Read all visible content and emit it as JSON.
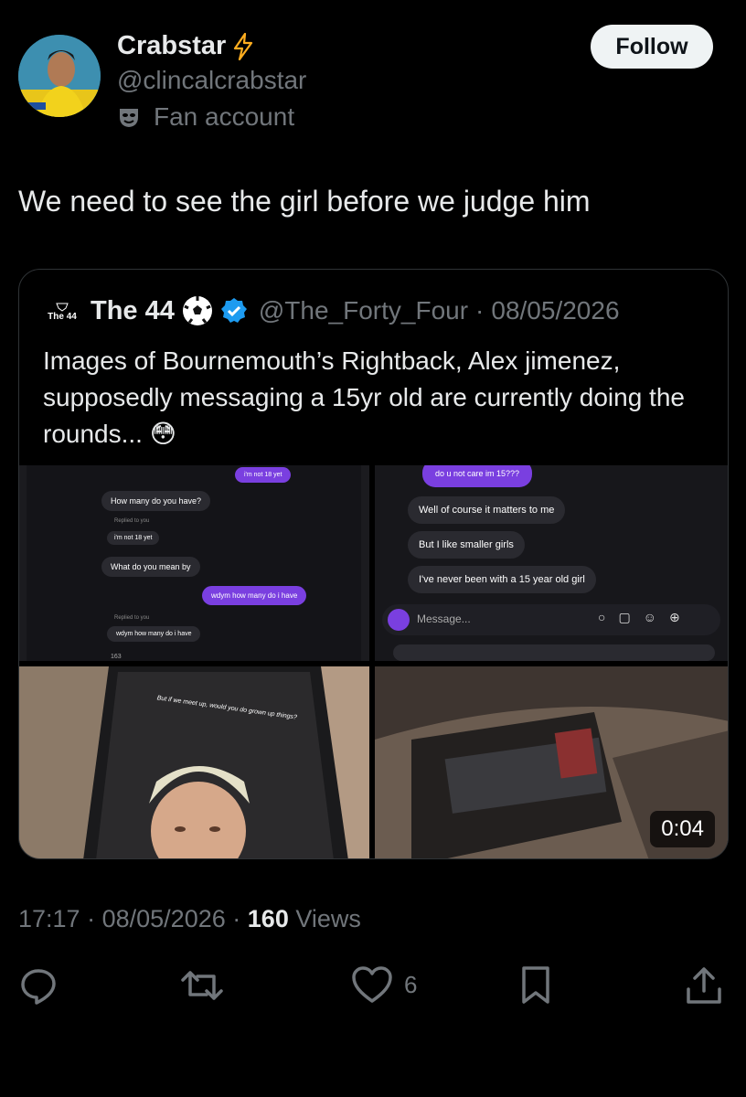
{
  "author": {
    "name": "Crabstar",
    "handle": "@clincalcrabstar",
    "label": "Fan account",
    "badge_icon": "lightning-icon"
  },
  "follow_label": "Follow",
  "tweet_text": "We need to see the girl before we judge him",
  "quote": {
    "avatar_text": "The 44",
    "name": "The 44",
    "handle": "@The_Forty_Four",
    "separator": "·",
    "date": "08/05/2026",
    "text": "Images of Bournemouth’s Rightback, Alex jimenez, supposedly messaging a 15yr old are currently doing the rounds...",
    "emoji": "😳",
    "media": {
      "tile1": {
        "msg_top": "i'm not 18 yet",
        "msg_1": "How many do you have?",
        "replied_1": "Replied to you",
        "reply_1": "i'm not 18 yet",
        "msg_2": "What do you mean by",
        "msg_3": "wdym how many do i have",
        "replied_2": "Replied to you",
        "reply_2": "wdym how many do i have",
        "cut": "163"
      },
      "tile2": {
        "msg_top": "do u not care im 15???",
        "msg_1": "Well of course it matters to me",
        "msg_2": "But I like smaller girls",
        "msg_3": "I've never been with a 15 year old girl",
        "input_placeholder": "Message..."
      },
      "tile3": {
        "caption": "But if we meet up, would you do grown up things?"
      },
      "duration": "0:04"
    }
  },
  "meta": {
    "time": "17:17",
    "dot": "·",
    "date": "08/05/2026",
    "views_count": "160",
    "views_label": "Views"
  },
  "actions": {
    "reply_icon": "reply-icon",
    "retweet_icon": "retweet-icon",
    "like_icon": "heart-icon",
    "like_count": "6",
    "bookmark_icon": "bookmark-icon",
    "share_icon": "share-icon"
  },
  "colors": {
    "background": "#000000",
    "text": "#e7e9ea",
    "muted": "#71767b",
    "verified": "#1d9bf0",
    "lightning": "#ffad1f"
  }
}
